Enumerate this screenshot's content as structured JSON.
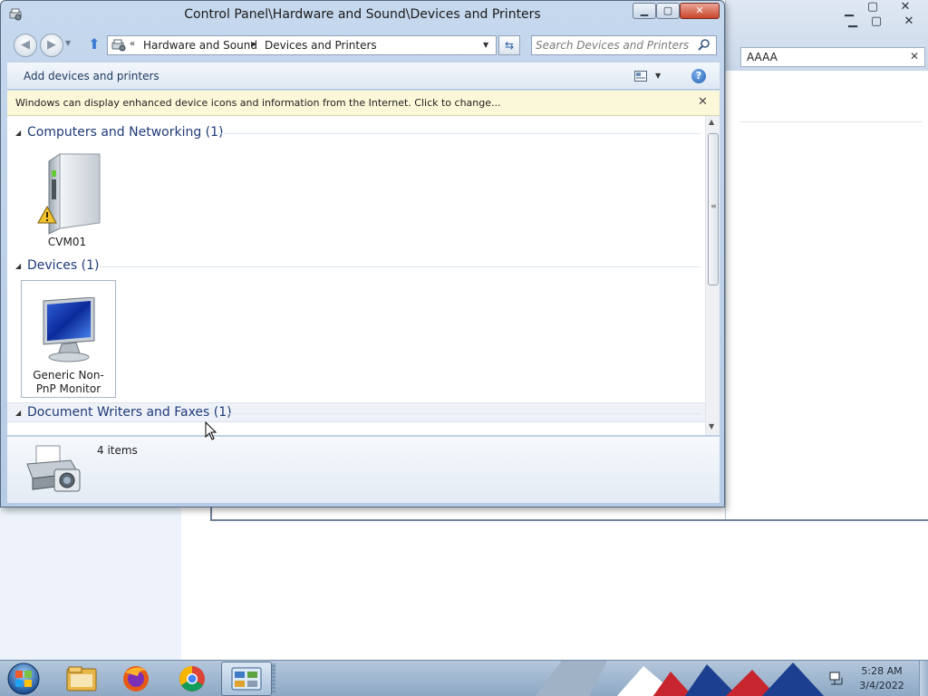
{
  "window": {
    "title": "Control Panel\\Hardware and Sound\\Devices and Printers",
    "min_label": "▁",
    "max_label": "▢",
    "close_label": "✕"
  },
  "nav": {
    "back_label": "◀",
    "forward_label": "▶",
    "recent_label": "▼",
    "up_label": "⬆",
    "overflow_chevron": "«",
    "breadcrumb": [
      "Hardware and Sound",
      "Devices and Printers"
    ],
    "separator": "▶",
    "dropdown_label": "▼",
    "refresh_label": "⇆",
    "search_placeholder": "Search Devices and Printers"
  },
  "commandbar": {
    "add_label": "Add devices and printers",
    "view_dropdown": "▼",
    "help_label": "?"
  },
  "infobar": {
    "text": "Windows can display enhanced device icons and information from the Internet. Click to change...",
    "close_label": "✕"
  },
  "groups": [
    {
      "title": "Computers and Networking (1)",
      "toggle": "◢"
    },
    {
      "title": "Devices (1)",
      "toggle": "◢"
    },
    {
      "title": "Document Writers and Faxes (1)",
      "toggle": "◢"
    }
  ],
  "devices": [
    {
      "label": "CVM01",
      "icon": "computer-icon",
      "status": "warning"
    },
    {
      "label": "Generic Non-PnP Monitor",
      "icon": "monitor-icon",
      "selected": true
    }
  ],
  "scrollbar": {
    "up_label": "▲",
    "down_label": "▼",
    "grip": "≡"
  },
  "details": {
    "count": "4 items",
    "icon": "printer-camera-icon"
  },
  "background_window": {
    "search_value": "AAAA",
    "clear_label": "✕",
    "min_label": "▁",
    "max_label": "▢",
    "close_label": "✕"
  },
  "taskbar": {
    "apps": [
      "windows-explorer",
      "firefox",
      "chrome",
      "control-panel"
    ],
    "active_app": "control-panel",
    "time": "5:28 AM",
    "date": "3/4/2022"
  },
  "colors": {
    "title_bar": "#c6d8ee",
    "info_bar": "#fbf7d9",
    "group_title": "#1e3a78",
    "close_button": "#c9452c"
  }
}
